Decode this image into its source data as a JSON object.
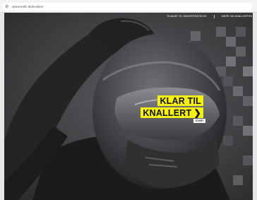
{
  "browser": {
    "url": "sikkertrafik.dk/knallert/",
    "address_icon": "tune-icon"
  },
  "nav": {
    "items": [
      {
        "label": "TILBAGE TIL SIKKERTRAFIK.DK"
      },
      {
        "label": "MERE OM KNALLERTEN"
      }
    ]
  },
  "hero": {
    "line1": "KLAR TIL",
    "line2": "KNALLERT",
    "arrow": "❯",
    "start_label": "START"
  },
  "colors": {
    "accent_yellow": "#f5ef12",
    "background": "#4a4c4f"
  }
}
